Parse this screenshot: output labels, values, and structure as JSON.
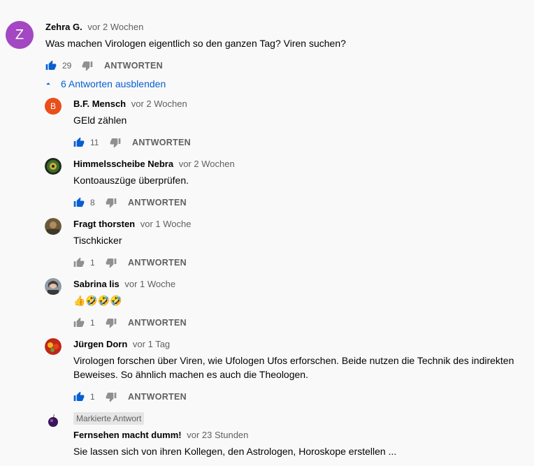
{
  "top_comment": {
    "avatar_letter": "Z",
    "author": "Zehra G.",
    "time": "vor 2 Wochen",
    "text": "Was machen Virologen eigentlich so den ganzen Tag? Viren suchen?",
    "likes": "29",
    "reply_label": "ANTWORTEN"
  },
  "toggle_label": "6 Antworten ausblenden",
  "replies": [
    {
      "avatar_letter": "B",
      "author": "B.F. Mensch",
      "time": "vor 2 Wochen",
      "text": "GEld zählen",
      "likes": "11",
      "reply_label": "ANTWORTEN",
      "liked": true
    },
    {
      "author": "Himmelsscheibe Nebra",
      "time": "vor 2 Wochen",
      "text": "Kontoauszüge überprüfen.",
      "likes": "8",
      "reply_label": "ANTWORTEN",
      "liked": true
    },
    {
      "author": "Fragt thorsten",
      "time": "vor 1 Woche",
      "text": "Tischkicker",
      "likes": "1",
      "reply_label": "ANTWORTEN",
      "liked": false
    },
    {
      "author": "Sabrina lis",
      "time": "vor 1 Woche",
      "text": "👍🤣🤣🤣",
      "likes": "1",
      "reply_label": "ANTWORTEN",
      "liked": false
    },
    {
      "author": "Jürgen Dorn",
      "time": "vor 1 Tag",
      "text": "Virologen forschen über Viren, wie Ufologen Ufos erforschen. Beide nutzen die Technik des indirekten Beweises. So ähnlich machen es auch die Theologen.",
      "likes": "1",
      "reply_label": "ANTWORTEN",
      "liked": true
    },
    {
      "badge": "Markierte Antwort",
      "author": "Fernsehen macht dumm!",
      "time": "vor 23 Stunden",
      "text": "Sie lassen sich von ihren Kollegen, den Astrologen, Horoskope erstellen ..."
    }
  ],
  "colors": {
    "accent_blue": "#065fd4",
    "liked_blue": "#065fd4",
    "icon_grey": "#909090",
    "top_avatar": "#a347c2",
    "reply_avatar_b": "#e94e1b"
  },
  "icons": [
    "thumbs-up-icon",
    "thumbs-down-icon",
    "chevron-up-icon"
  ]
}
